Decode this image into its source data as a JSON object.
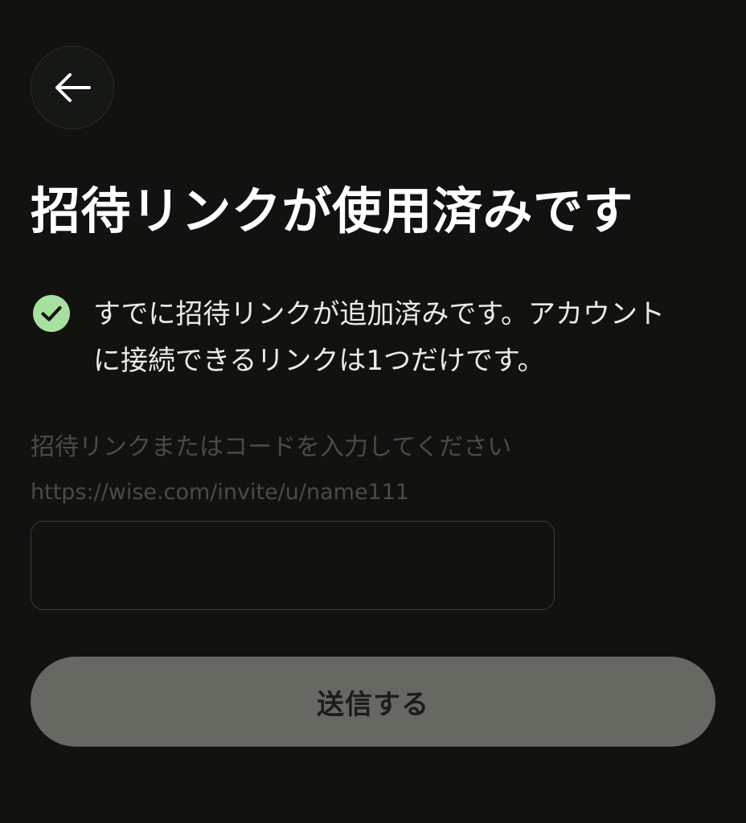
{
  "header": {
    "back_icon": "arrow-left-icon"
  },
  "title": "招待リンクが使用済みです",
  "status": {
    "icon": "check-circle-icon",
    "icon_color": "#a7e0a0",
    "text": "すでに招待リンクが追加済みです。アカウントに接続できるリンクは1つだけです。"
  },
  "form": {
    "label": "招待リンクまたはコードを入力してください",
    "hint": "https://wise.com/invite/u/name111",
    "input_value": ""
  },
  "submit": {
    "label": "送信する",
    "background": "#666862"
  }
}
